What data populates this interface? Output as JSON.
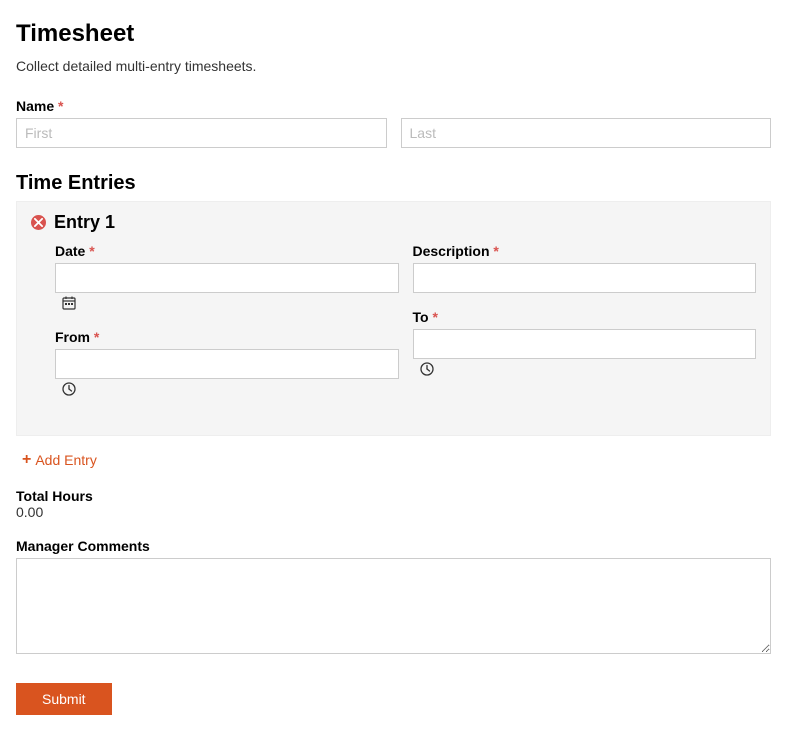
{
  "header": {
    "title": "Timesheet",
    "subtitle": "Collect detailed multi-entry timesheets."
  },
  "name": {
    "label": "Name",
    "first_placeholder": "First",
    "last_placeholder": "Last"
  },
  "time_entries": {
    "section_title": "Time Entries",
    "entries": [
      {
        "title": "Entry 1",
        "date_label": "Date",
        "description_label": "Description",
        "from_label": "From",
        "to_label": "To"
      }
    ],
    "add_label": "Add Entry"
  },
  "totals": {
    "label": "Total Hours",
    "value": "0.00"
  },
  "comments": {
    "label": "Manager Comments"
  },
  "submit": {
    "label": "Submit"
  },
  "required_marker": "*"
}
